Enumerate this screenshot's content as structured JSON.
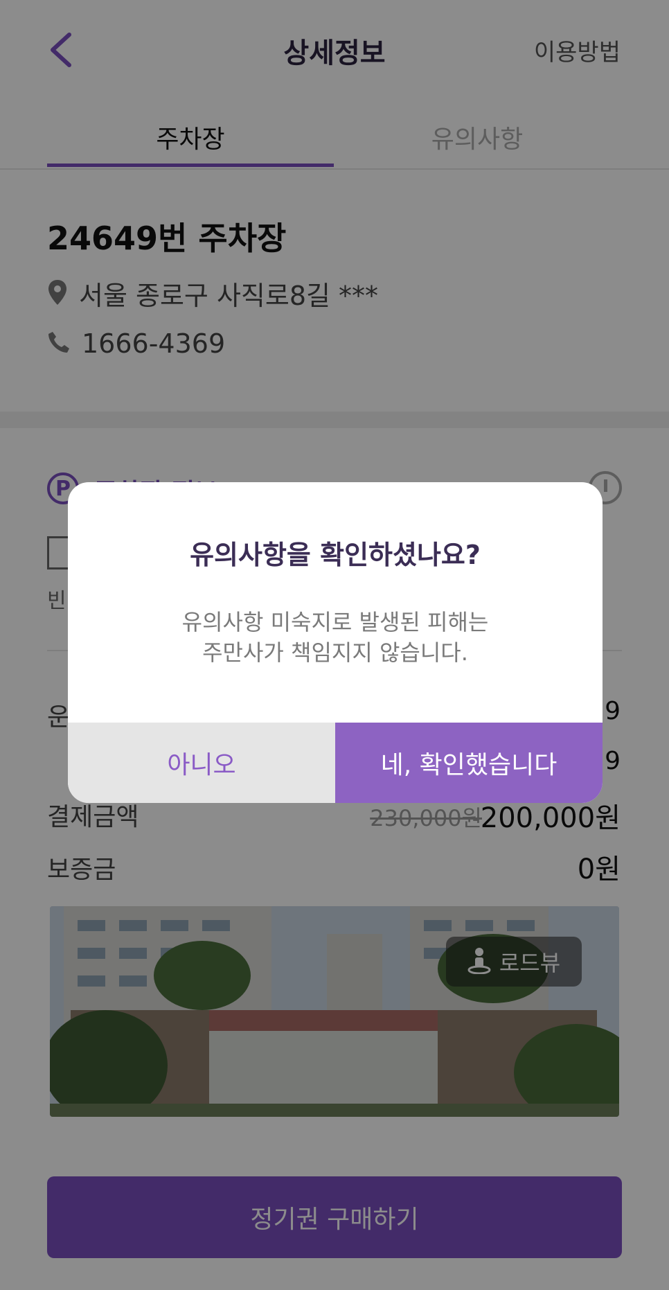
{
  "header": {
    "title": "상세정보",
    "help_label": "이용방법"
  },
  "tabs": {
    "parking": "주차장",
    "caution": "유의사항"
  },
  "lot": {
    "name": "24649번 주차장",
    "address": "서울 종로구 사직로8길 ***",
    "phone": "1666-4369"
  },
  "section": {
    "p_label": "P",
    "title": "주차장 정보",
    "empty_label": "빈"
  },
  "rows": {
    "r1_label": "운",
    "r1_value": "9",
    "r2_value": "9",
    "payment_label": "결제금액",
    "old_price": "230,000원",
    "new_price": "200,000원",
    "deposit_label": "보증금",
    "deposit_value": "0원"
  },
  "photo": {
    "roadview_label": "로드뷰"
  },
  "cta": {
    "buy_label": "정기권 구매하기"
  },
  "modal": {
    "title": "유의사항을 확인하셨나요?",
    "body_line1": "유의사항 미숙지로 발생된 피해는",
    "body_line2": "주만사가 책임지지 않습니다.",
    "no_label": "아니오",
    "yes_label": "네, 확인했습니다"
  },
  "icons": {
    "back": "chevron-left-icon",
    "location": "map-pin-icon",
    "phone": "phone-icon",
    "info": "info-icon",
    "roadview": "person-pin-icon"
  },
  "colors": {
    "accent": "#7a4fc0",
    "confirm_button": "#8d63c2",
    "cancel_button": "#e5e5e5"
  }
}
